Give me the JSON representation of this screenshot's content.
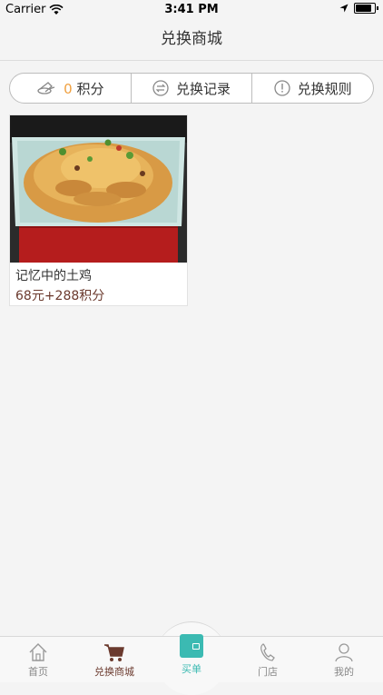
{
  "status_bar": {
    "carrier": "Carrier",
    "time": "3:41 PM",
    "battery_level": 0.85
  },
  "nav": {
    "title": "兑换商城"
  },
  "segment": {
    "points_value": "0",
    "points_label": "积分",
    "records_label": "兑换记录",
    "rules_label": "兑换规则"
  },
  "products": [
    {
      "name": "记忆中的土鸡",
      "price": "68元+288积分"
    }
  ],
  "tab_bar": {
    "home": "首页",
    "mall": "兑换商城",
    "pay": "买单",
    "store": "门店",
    "mine": "我的"
  },
  "colors": {
    "accent": "#6b3a2e",
    "points": "#f0a040",
    "pay": "#3bbab2"
  }
}
